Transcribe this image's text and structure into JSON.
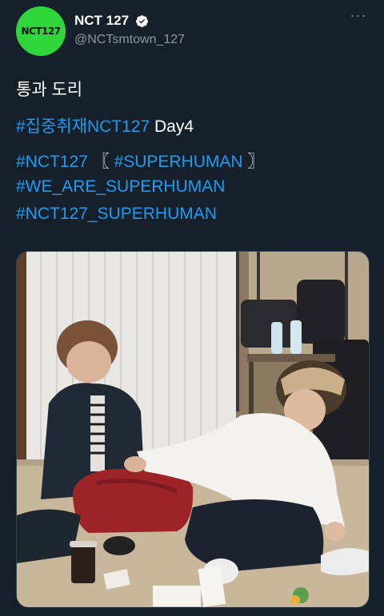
{
  "account": {
    "avatar_text": "NCT127",
    "display_name": "NCT 127",
    "handle": "@NCTsmtown_127"
  },
  "tweet": {
    "line1": "통과 도리",
    "line2_tag": "#집중취재NCT127",
    "line2_text": " Day4",
    "line3_tag1": "#NCT127",
    "line3_bracket_open": " 〖 ",
    "line3_tag2": "#SUPERHUMAN",
    "line3_bracket_close": " 〗",
    "line4_tag": "#WE_ARE_SUPERHUMAN",
    "line5_tag": "#NCT127_SUPERHUMAN"
  },
  "icons": {
    "verified": "verified-badge-icon",
    "more": "more-options-icon"
  },
  "colors": {
    "background": "#15202b",
    "hashtag": "#1d9bf0",
    "secondary": "#8b98a5",
    "avatar": "#2ed63c"
  }
}
